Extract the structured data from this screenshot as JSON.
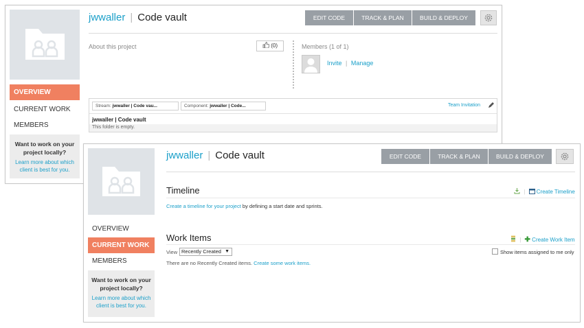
{
  "window_back": {
    "header": {
      "user": "jwwaller",
      "separator": "|",
      "project": "Code vault"
    },
    "toolbar": {
      "edit_code": "EDIT CODE",
      "track_plan": "TRACK & PLAN",
      "build_deploy": "BUILD & DEPLOY"
    },
    "nav": {
      "overview": "OVERVIEW",
      "current_work": "CURRENT WORK",
      "members": "MEMBERS",
      "active": "overview"
    },
    "promo": {
      "title": "Want to work on your project locally?",
      "link": "Learn more about which client is best for you."
    },
    "about": {
      "label": "About this project",
      "like_count": "(0)"
    },
    "members": {
      "label": "Members (1 of 1)",
      "invite": "Invite",
      "sep": "|",
      "manage": "Manage"
    },
    "files": {
      "stream_label": "Stream:",
      "stream_value": "jwwaller | Code vau...",
      "component_label": "Component:",
      "component_value": "jwwaller | Code...",
      "team_invitation": "Team Invitation",
      "folder_name": "jwwaller | Code vault",
      "empty_message": "This folder is empty."
    }
  },
  "window_front": {
    "header": {
      "user": "jwwaller",
      "separator": "|",
      "project": "Code vault"
    },
    "toolbar": {
      "edit_code": "EDIT CODE",
      "track_plan": "TRACK & PLAN",
      "build_deploy": "BUILD & DEPLOY"
    },
    "nav": {
      "overview": "OVERVIEW",
      "current_work": "CURRENT WORK",
      "members": "MEMBERS",
      "active": "current_work"
    },
    "promo": {
      "title": "Want to work on your project locally?",
      "link": "Learn more about which client is best for you."
    },
    "timeline": {
      "heading": "Timeline",
      "create_link": "Create Timeline",
      "text_link": "Create a timeline for your project",
      "text_rest": " by defining a start date and sprints."
    },
    "work_items": {
      "heading": "Work Items",
      "create_link": "Create Work Item",
      "view_label": "View",
      "view_selected": "Recently Created",
      "show_assigned": "Show items assigned to me only",
      "empty_text": "There are no Recently Created items. ",
      "empty_link": "Create some work items."
    }
  },
  "colors": {
    "accent_link": "#1a9fc9",
    "nav_active": "#f08060",
    "button_bg": "#999fa5",
    "thumb_bg": "#dfe3e7"
  }
}
